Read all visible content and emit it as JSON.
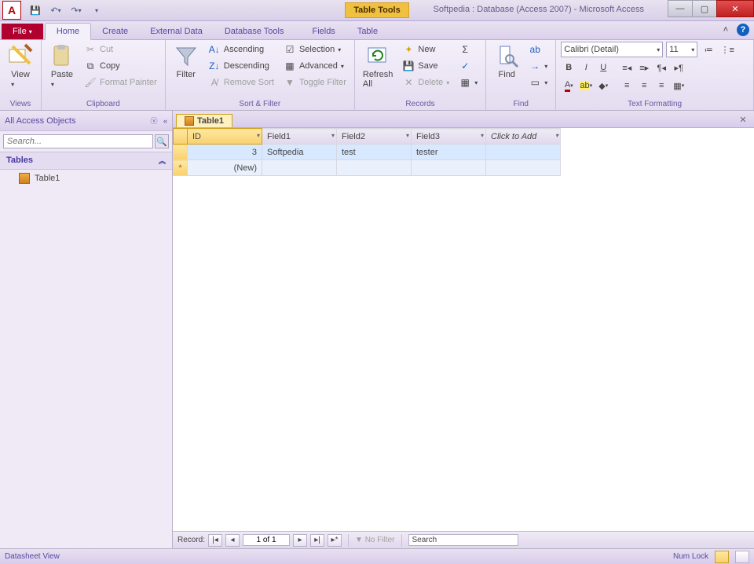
{
  "app": {
    "icon_letter": "A",
    "contextual_title": "Table Tools",
    "window_title": "Softpedia : Database (Access 2007)  -  Microsoft Access"
  },
  "qat": {
    "save": "💾",
    "undo": "↶",
    "redo": "↷",
    "dd": "▾"
  },
  "tabs": {
    "file": "File",
    "home": "Home",
    "create": "Create",
    "external": "External Data",
    "dbtools": "Database Tools",
    "fields": "Fields",
    "table": "Table"
  },
  "ribbon": {
    "views": {
      "view": "View",
      "label": "Views"
    },
    "clipboard": {
      "paste": "Paste",
      "cut": "Cut",
      "copy": "Copy",
      "fmt": "Format Painter",
      "label": "Clipboard"
    },
    "sortfilter": {
      "filter": "Filter",
      "asc": "Ascending",
      "desc": "Descending",
      "remove": "Remove Sort",
      "selection": "Selection",
      "advanced": "Advanced",
      "toggle": "Toggle Filter",
      "label": "Sort & Filter"
    },
    "records": {
      "refresh": "Refresh\nAll",
      "new": "New",
      "save": "Save",
      "delete": "Delete",
      "totals": "Σ",
      "spelling": "ᴬᴮ",
      "more": "⋯",
      "label": "Records"
    },
    "find": {
      "find": "Find",
      "replace": "↔",
      "goto": "→",
      "select": "▭",
      "label": "Find"
    },
    "textfmt": {
      "font": "Calibri (Detail)",
      "size": "11",
      "bold": "B",
      "italic": "I",
      "underline": "U",
      "label": "Text Formatting"
    }
  },
  "nav": {
    "header": "All Access Objects",
    "search_placeholder": "Search...",
    "cat": "Tables",
    "items": [
      "Table1"
    ]
  },
  "doc": {
    "tab": "Table1"
  },
  "table": {
    "headers": [
      "ID",
      "Field1",
      "Field2",
      "Field3"
    ],
    "click_to_add": "Click to Add",
    "rows": [
      {
        "id": "3",
        "f1": "Softpedia",
        "f2": "test",
        "f3": "tester"
      }
    ],
    "new_label": "(New)"
  },
  "recnav": {
    "label": "Record:",
    "pos": "1 of 1",
    "nofilter": "No Filter",
    "search": "Search"
  },
  "status": {
    "left": "Datasheet View",
    "numlock": "Num Lock"
  }
}
